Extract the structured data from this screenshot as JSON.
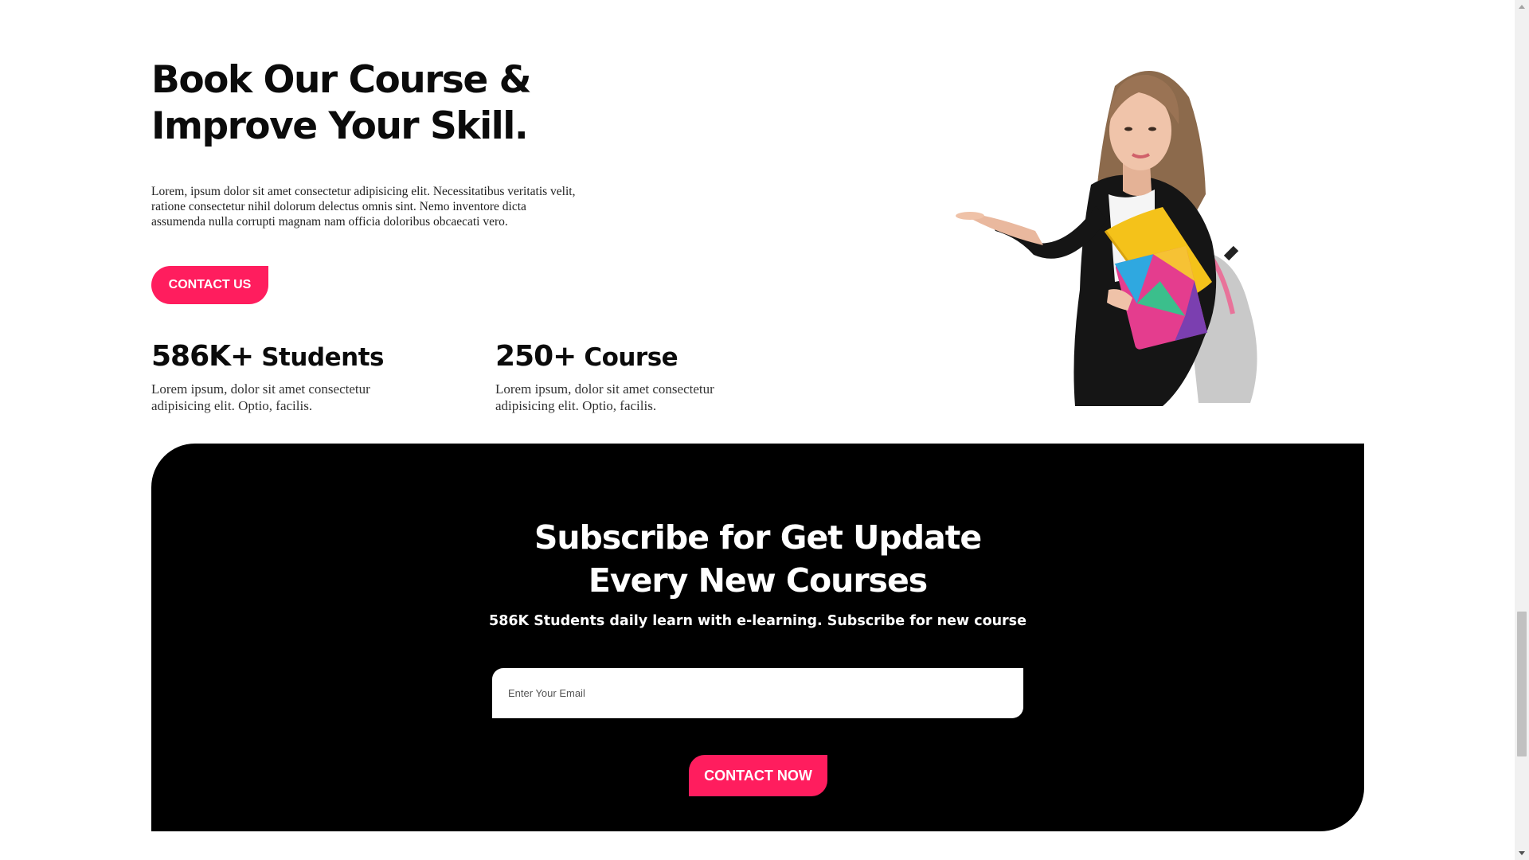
{
  "hero": {
    "title_line1": "Book Our Course &",
    "title_line2": "Improve Your Skill.",
    "description": "Lorem, ipsum dolor sit amet consectetur adipisicing elit. Necessitatibus veritatis velit, ratione consectetur nihil dolorum delectus omnis sint. Nemo inventore dicta assumenda nulla corrupti magnam nam officia doloribus obcaecati vero.",
    "contact_button": "CONTACT US"
  },
  "stats": [
    {
      "number": "586K+",
      "label": "Students",
      "description": "Lorem ipsum, dolor sit amet consectetur adipisicing elit. Optio, facilis."
    },
    {
      "number": "250+",
      "label": "Course",
      "description": "Lorem ipsum, dolor sit amet consectetur adipisicing elit. Optio, facilis."
    }
  ],
  "illustration": {
    "icon": "student-with-books-illustration"
  },
  "subscribe": {
    "title_line1": "Subscribe for Get Update",
    "title_line2": "Every New Courses",
    "description": "586K Students daily learn with e-learning. Subscribe for new course",
    "email_placeholder": "Enter Your Email",
    "email_value": "",
    "button": "CONTACT NOW"
  },
  "colors": {
    "accent": "#ff1d5e",
    "subscribe_bg": "#000000",
    "page_bg": "#ffffff"
  }
}
